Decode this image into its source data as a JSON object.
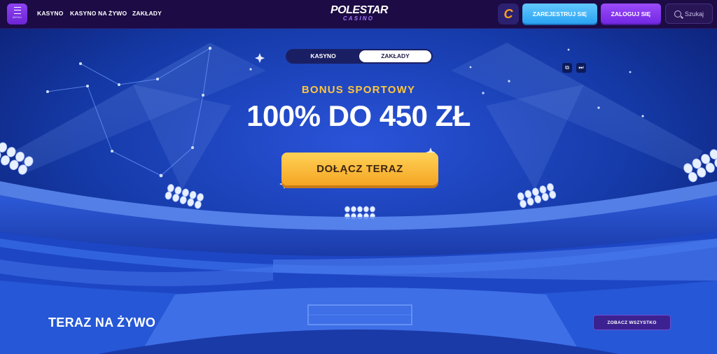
{
  "header": {
    "menu_label": "MENU",
    "nav": [
      "KASYNO",
      "KASYNO NA ŻYWO",
      "ZAKŁADY"
    ],
    "logo_main": "POLESTAR",
    "logo_sub": "CASINO",
    "register_label": "ZAREJESTRUJ SIĘ",
    "login_label": "ZALOGUJ SIĘ",
    "search_label": "Szukaj"
  },
  "hero": {
    "tabs": [
      {
        "label": "KASYNO",
        "active": false
      },
      {
        "label": "ZAKŁADY",
        "active": true
      }
    ],
    "bonus_label": "BONUS SPORTOWY",
    "bonus_amount": "100% DO 450 ZŁ",
    "cta_label": "DOŁĄCZ TERAZ"
  },
  "live": {
    "title": "TERAZ NA ŻYWO",
    "see_all_label": "ZOBACZ WSZYSTKO"
  },
  "colors": {
    "header_bg": "#1c0b44",
    "accent_purple": "#7327e3",
    "accent_blue": "#2aa3f2",
    "cta_yellow": "#ffc63d",
    "hero_bg": "#0c1d6e"
  },
  "icons": [
    "menu-icon",
    "casino-c-icon",
    "search-icon",
    "picture-in-picture-icon",
    "skip-icon",
    "star-icon"
  ]
}
